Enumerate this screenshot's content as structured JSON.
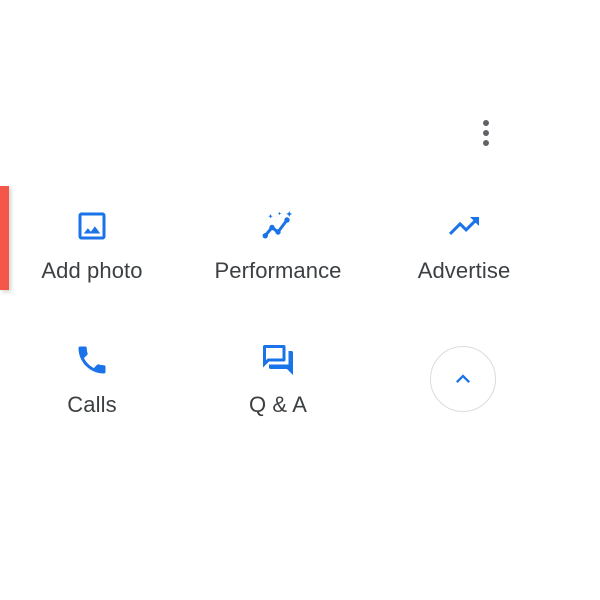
{
  "colors": {
    "accent_blue": "#1a73e8",
    "label_gray": "#3c4043",
    "icon_gray": "#5f6368",
    "tab_red": "#f4574a"
  },
  "menu": {
    "icon": "more-vert-icon"
  },
  "actions": [
    {
      "label": "Add photo",
      "icon": "image-icon"
    },
    {
      "label": "Performance",
      "icon": "performance-icon"
    },
    {
      "label": "Advertise",
      "icon": "trending-up-icon"
    },
    {
      "label": "Calls",
      "icon": "phone-icon"
    },
    {
      "label": "Q & A",
      "icon": "forum-icon"
    }
  ],
  "collapse": {
    "icon": "chevron-up-icon"
  }
}
